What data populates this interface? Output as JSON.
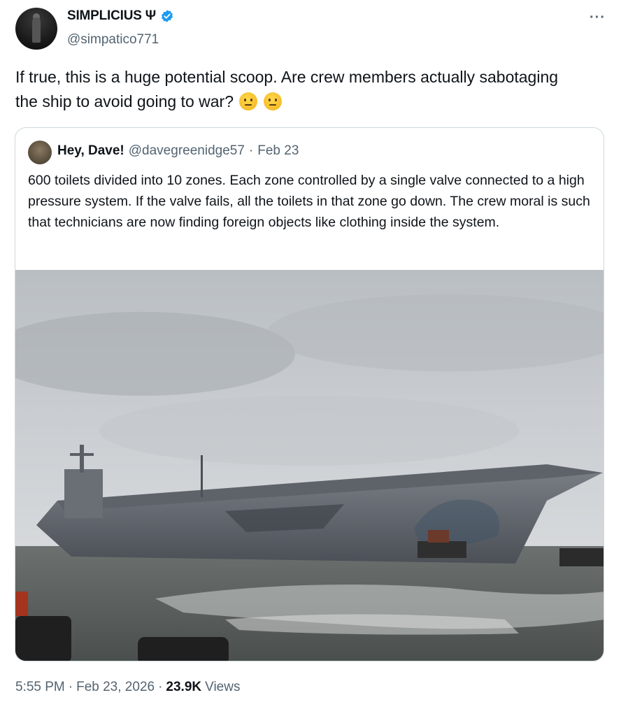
{
  "author": {
    "display_name": "SIMPLICIUS Ψ",
    "handle": "@simpatico771"
  },
  "more_icon": "···",
  "tweet": {
    "text": "If true, this is a huge potential scoop. Are crew members actually sabotaging the ship to avoid going to war?",
    "emojis": [
      "thinking-face-icon",
      "face-with-raised-eyebrow-icon"
    ]
  },
  "quoted": {
    "display_name": "Hey, Dave!",
    "handle": "@davegreenidge57",
    "separator": "·",
    "date": "Feb 23",
    "text": "600 toilets divided into 10 zones. Each zone controlled by a single valve connected to a high pressure system. If the valve fails, all the toilets in that zone go down. The crew moral is such that technicians are now finding foreign objects like clothing inside the system."
  },
  "footer": {
    "time": "5:55 PM",
    "sep1": "·",
    "date": "Feb 23, 2026",
    "sep2": "·",
    "views_count": "23.9K",
    "views_label": "Views"
  },
  "colors": {
    "verified_blue": "#1d9bf0",
    "secondary_text": "#536471",
    "border": "#cfd9de"
  }
}
